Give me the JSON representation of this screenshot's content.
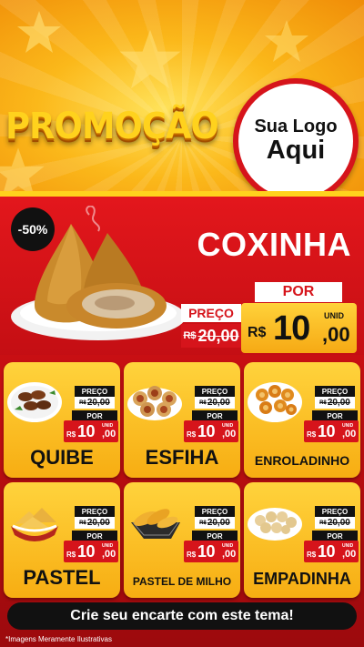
{
  "colors": {
    "yellow": "#ffd21d",
    "red": "#d6141b",
    "dark": "#111111"
  },
  "header": {
    "title": "PROMOÇÃO",
    "logo_line1": "Sua Logo",
    "logo_line2": "Aqui"
  },
  "featured": {
    "discount": "-50%",
    "name": "COXINHA",
    "price_label": "PREÇO",
    "old_currency": "R$",
    "old_price": "20,00",
    "por_label": "POR",
    "currency": "R$",
    "new_int": "10",
    "new_dec": ",00",
    "unit": "UNID",
    "image": "coxinha-image"
  },
  "products": [
    {
      "name": "QUIBE",
      "image": "quibe-image",
      "price_label": "PREÇO",
      "old_currency": "R$",
      "old_price": "20,00",
      "por_label": "POR",
      "currency": "R$",
      "new_int": "10",
      "new_dec": ",00",
      "unit": "UNID"
    },
    {
      "name": "ESFIHA",
      "image": "esfiha-image",
      "price_label": "PREÇO",
      "old_currency": "R$",
      "old_price": "20,00",
      "por_label": "POR",
      "currency": "R$",
      "new_int": "10",
      "new_dec": ",00",
      "unit": "UNID"
    },
    {
      "name": "ENROLADINHO",
      "image": "enroladinho-image",
      "price_label": "PREÇO",
      "old_currency": "R$",
      "old_price": "20,00",
      "por_label": "POR",
      "currency": "R$",
      "new_int": "10",
      "new_dec": ",00",
      "unit": "UNID"
    },
    {
      "name": "PASTEL",
      "image": "pastel-image",
      "price_label": "PREÇO",
      "old_currency": "R$",
      "old_price": "20,00",
      "por_label": "POR",
      "currency": "R$",
      "new_int": "10",
      "new_dec": ",00",
      "unit": "UNID"
    },
    {
      "name": "PASTEL DE MILHO",
      "image": "pastel-de-milho-image",
      "price_label": "PREÇO",
      "old_currency": "R$",
      "old_price": "20,00",
      "por_label": "POR",
      "currency": "R$",
      "new_int": "10",
      "new_dec": ",00",
      "unit": "UNID"
    },
    {
      "name": "EMPADINHA",
      "image": "empadinha-image",
      "price_label": "PREÇO",
      "old_currency": "R$",
      "old_price": "20,00",
      "por_label": "POR",
      "currency": "R$",
      "new_int": "10",
      "new_dec": ",00",
      "unit": "UNID"
    }
  ],
  "footer": {
    "cta": "Crie seu encarte com este tema!",
    "disclaimer": "*Imagens Meramente Ilustrativas"
  }
}
